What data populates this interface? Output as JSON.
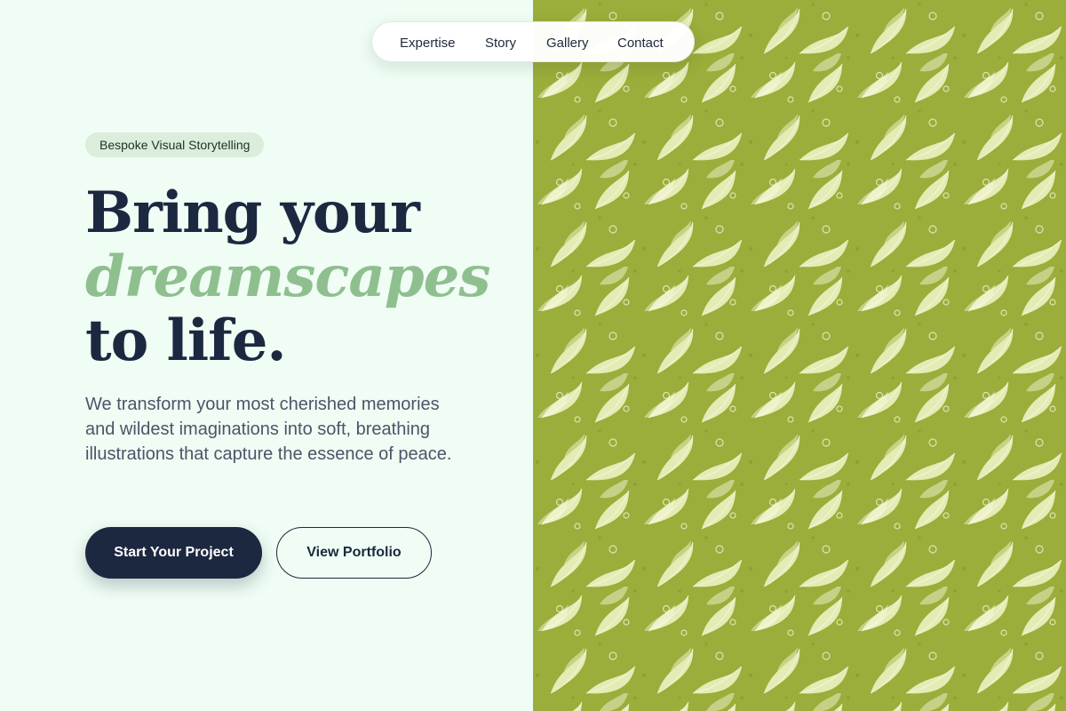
{
  "nav": {
    "items": [
      {
        "label": "Expertise"
      },
      {
        "label": "Story"
      },
      {
        "label": "Gallery"
      },
      {
        "label": "Contact"
      }
    ]
  },
  "hero": {
    "badge": "Bespoke Visual Storytelling",
    "headline": {
      "line1": "Bring your",
      "line2": "dreamscapes",
      "line3": "to life."
    },
    "subtitle": "We transform your most cherished memories and wildest imaginations into soft, breathing illustrations that capture the essence of peace.",
    "primary_button": "Start Your Project",
    "secondary_button": "View Portfolio"
  },
  "theme": {
    "background": "#effdf4",
    "navy": "#1c2840",
    "sage_accent": "#8fbf8f",
    "pattern_green": "#9bad3a",
    "pattern_leaf": "#eef2c2"
  },
  "artwork": {
    "description_icon": "botanical-leaf-pattern"
  }
}
